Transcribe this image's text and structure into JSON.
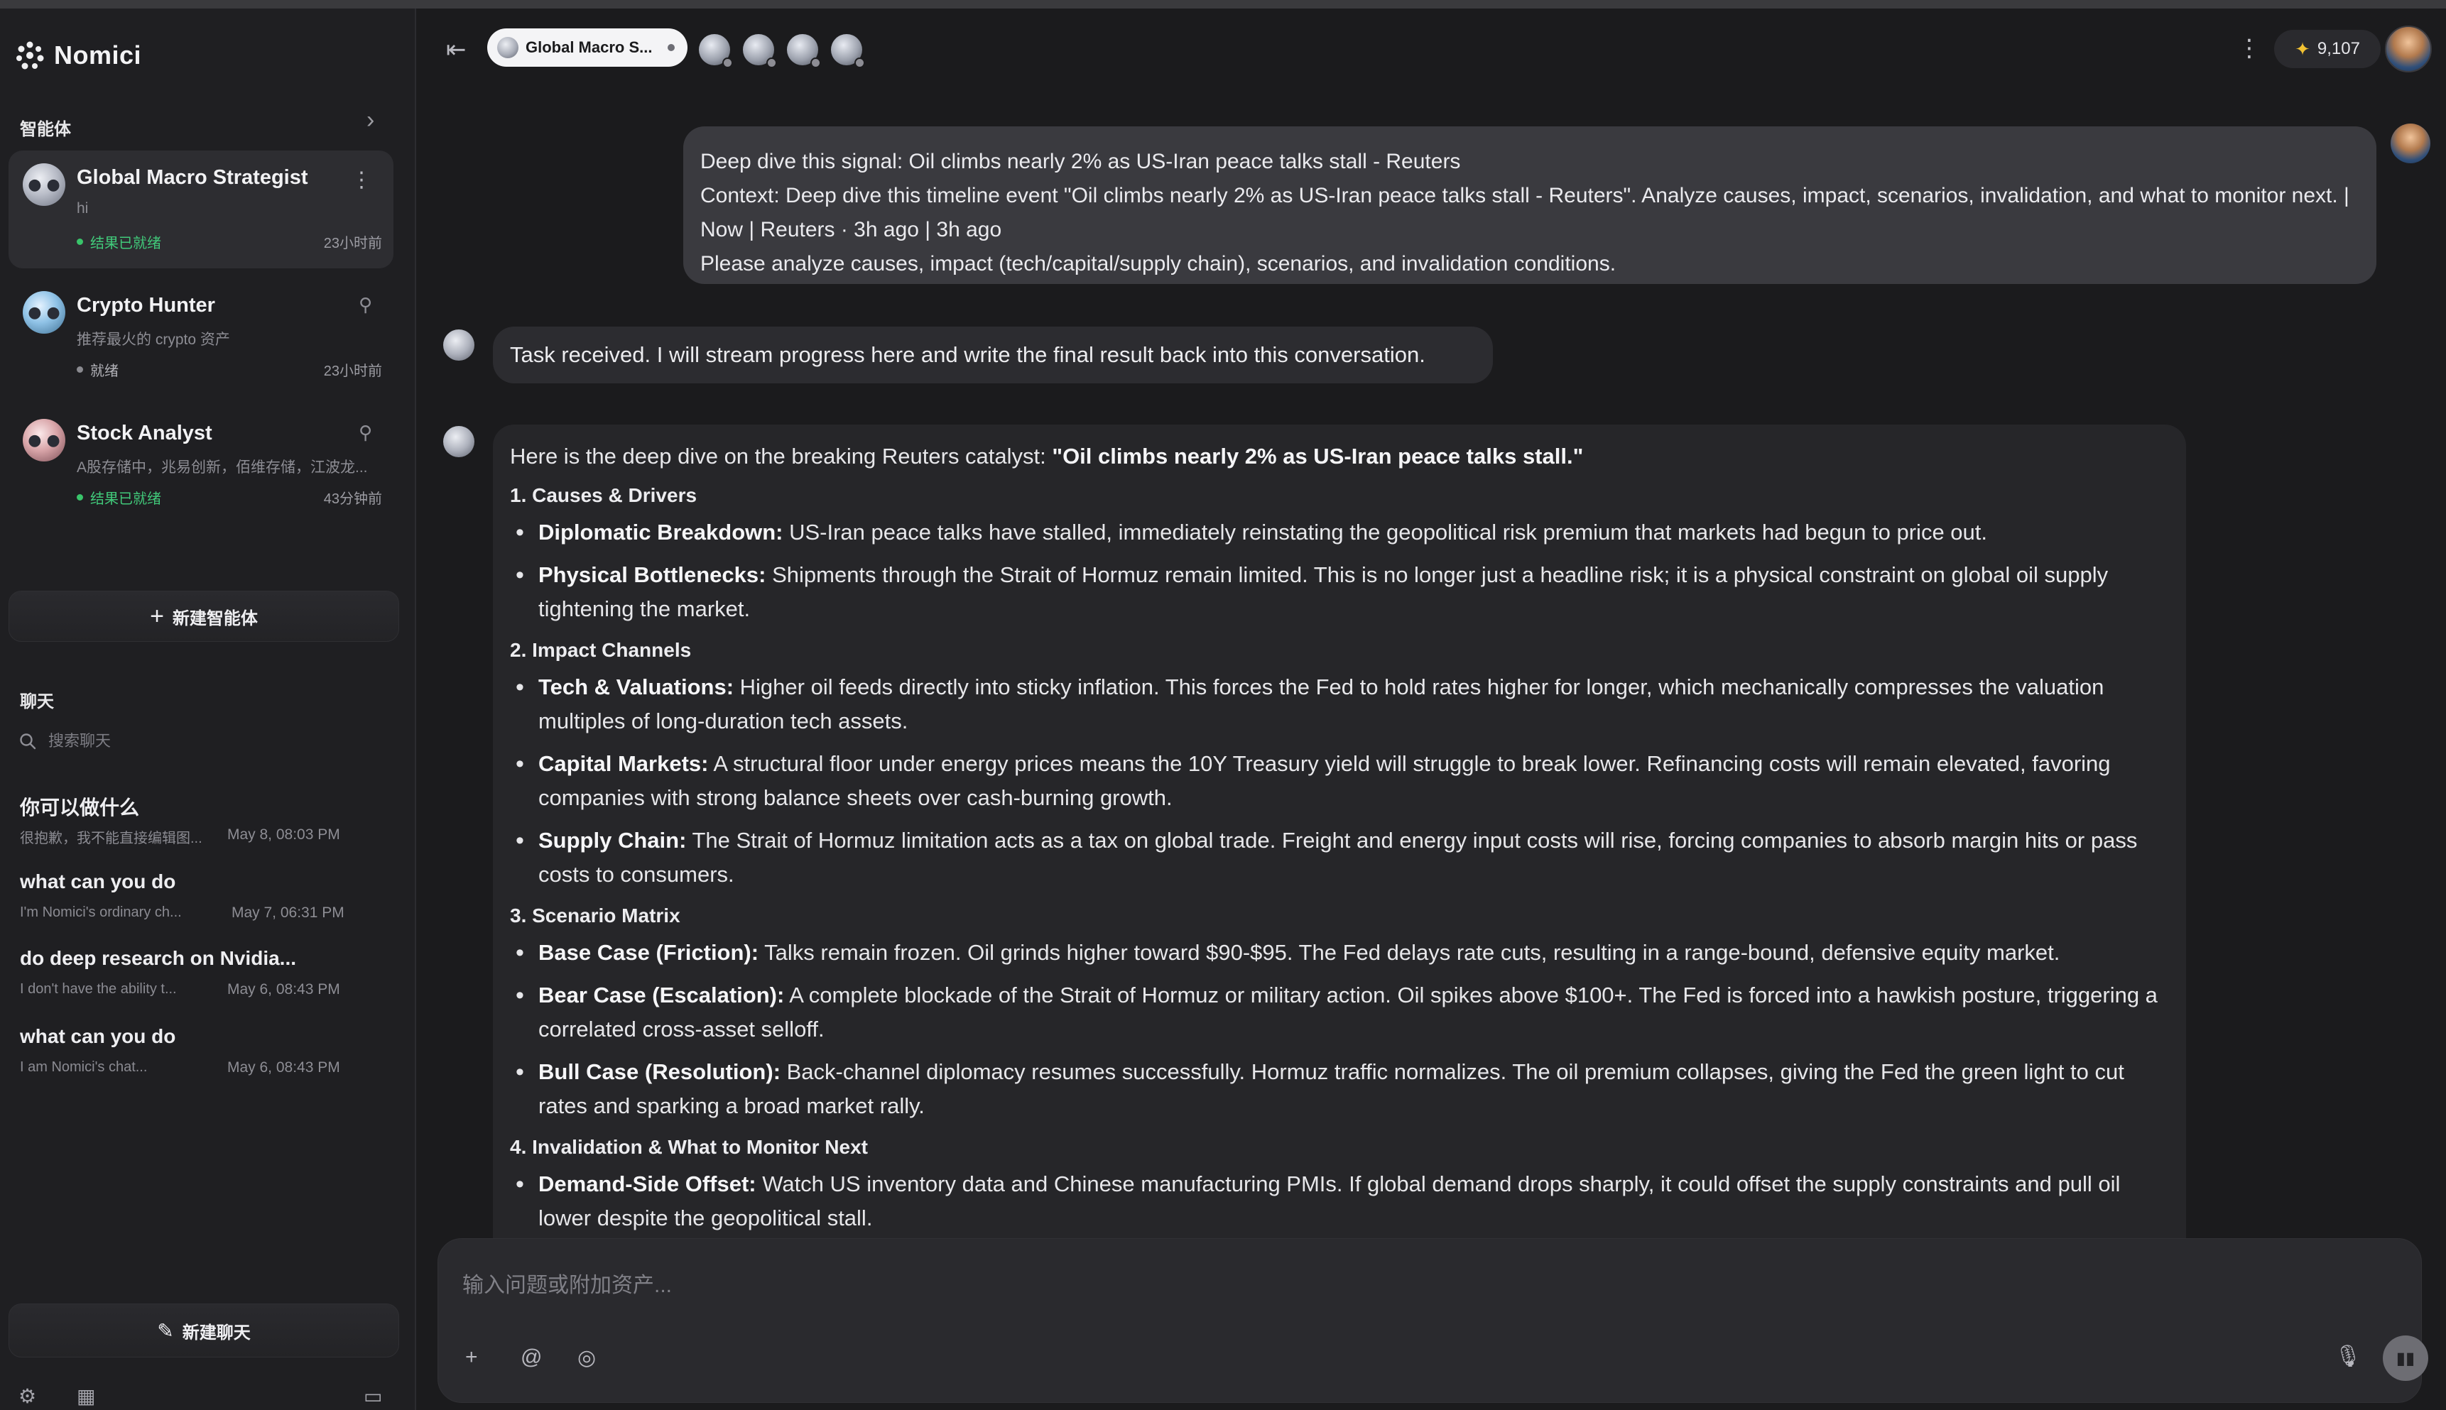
{
  "app": {
    "name": "Nomici"
  },
  "sidebar": {
    "agents_heading": "智能体",
    "agents": [
      {
        "name": "Global Macro Strategist",
        "subtitle": "hi",
        "status": "结果已就绪",
        "time": "23小时前",
        "active": true
      },
      {
        "name": "Crypto Hunter",
        "subtitle": "推荐最火的 crypto 资产",
        "status": "就绪",
        "time": "23小时前",
        "active": false
      },
      {
        "name": "Stock Analyst",
        "subtitle": "A股存储中，兆易创新，佰维存储，江波龙...",
        "status": "结果已就绪",
        "time": "43分钟前",
        "active": false
      }
    ],
    "new_agent_label": "新建智能体",
    "chats_heading": "聊天",
    "search_placeholder": "搜索聊天",
    "chats": [
      {
        "title": "你可以做什么",
        "preview": "很抱歉，我不能直接编辑图...",
        "time": "May 8, 08:03 PM"
      },
      {
        "title": "what can you do",
        "preview": "I'm Nomici's ordinary ch...",
        "time": "May 7, 06:31 PM"
      },
      {
        "title": "do deep research on Nvidia...",
        "preview": "I don't have the ability t...",
        "time": "May 6, 08:43 PM"
      },
      {
        "title": "what can you do",
        "preview": "I am Nomici's chat...",
        "time": "May 6, 08:43 PM"
      }
    ],
    "new_chat_label": "新建聊天"
  },
  "header": {
    "active_tab": "Global Macro S...",
    "points": "9,107"
  },
  "messages": {
    "user_lines": [
      "Deep dive this signal: Oil climbs nearly 2% as US-Iran peace talks stall - Reuters",
      "Context: Deep dive this timeline event \"Oil climbs nearly 2% as US-Iran peace talks stall - Reuters\". Analyze causes, impact, scenarios, invalidation, and what to monitor next. | Now | Reuters · 3h ago | 3h ago",
      "Please analyze causes, impact (tech/capital/supply chain), scenarios, and invalidation conditions."
    ],
    "ack": "Task received. I will stream progress here and write the final result back into this conversation.",
    "answer": {
      "intro_prefix": "Here is the deep dive on the breaking Reuters catalyst: ",
      "intro_bold": "\"Oil climbs nearly 2% as US-Iran peace talks stall.\"",
      "sections": [
        {
          "heading": "1. Causes & Drivers",
          "points": [
            {
              "label": "Diplomatic Breakdown:",
              "text": " US-Iran peace talks have stalled, immediately reinstating the geopolitical risk premium that markets had begun to price out."
            },
            {
              "label": "Physical Bottlenecks:",
              "text": " Shipments through the Strait of Hormuz remain limited. This is no longer just a headline risk; it is a physical constraint on global oil supply tightening the market."
            }
          ]
        },
        {
          "heading": "2. Impact Channels",
          "points": [
            {
              "label": "Tech & Valuations:",
              "text": " Higher oil feeds directly into sticky inflation. This forces the Fed to hold rates higher for longer, which mechanically compresses the valuation multiples of long-duration tech assets."
            },
            {
              "label": "Capital Markets:",
              "text": " A structural floor under energy prices means the 10Y Treasury yield will struggle to break lower. Refinancing costs will remain elevated, favoring companies with strong balance sheets over cash-burning growth."
            },
            {
              "label": "Supply Chain:",
              "text": " The Strait of Hormuz limitation acts as a tax on global trade. Freight and energy input costs will rise, forcing companies to absorb margin hits or pass costs to consumers."
            }
          ]
        },
        {
          "heading": "3. Scenario Matrix",
          "points": [
            {
              "label": "Base Case (Friction):",
              "text": " Talks remain frozen. Oil grinds higher toward $90-$95. The Fed delays rate cuts, resulting in a range-bound, defensive equity market."
            },
            {
              "label": "Bear Case (Escalation):",
              "text": " A complete blockade of the Strait of Hormuz or military action. Oil spikes above $100+. The Fed is forced into a hawkish posture, triggering a correlated cross-asset selloff."
            },
            {
              "label": "Bull Case (Resolution):",
              "text": " Back-channel diplomacy resumes successfully. Hormuz traffic normalizes. The oil premium collapses, giving the Fed the green light to cut rates and sparking a broad market rally."
            }
          ]
        },
        {
          "heading": "4. Invalidation & What to Monitor Next",
          "points": [
            {
              "label": "Demand-Side Offset:",
              "text": " Watch US inventory data and Chinese manufacturing PMIs. If global demand drops sharply, it could offset the supply constraints and pull oil lower despite the geopolitical stall."
            }
          ]
        }
      ]
    }
  },
  "composer": {
    "placeholder": "输入问题或附加资产..."
  }
}
